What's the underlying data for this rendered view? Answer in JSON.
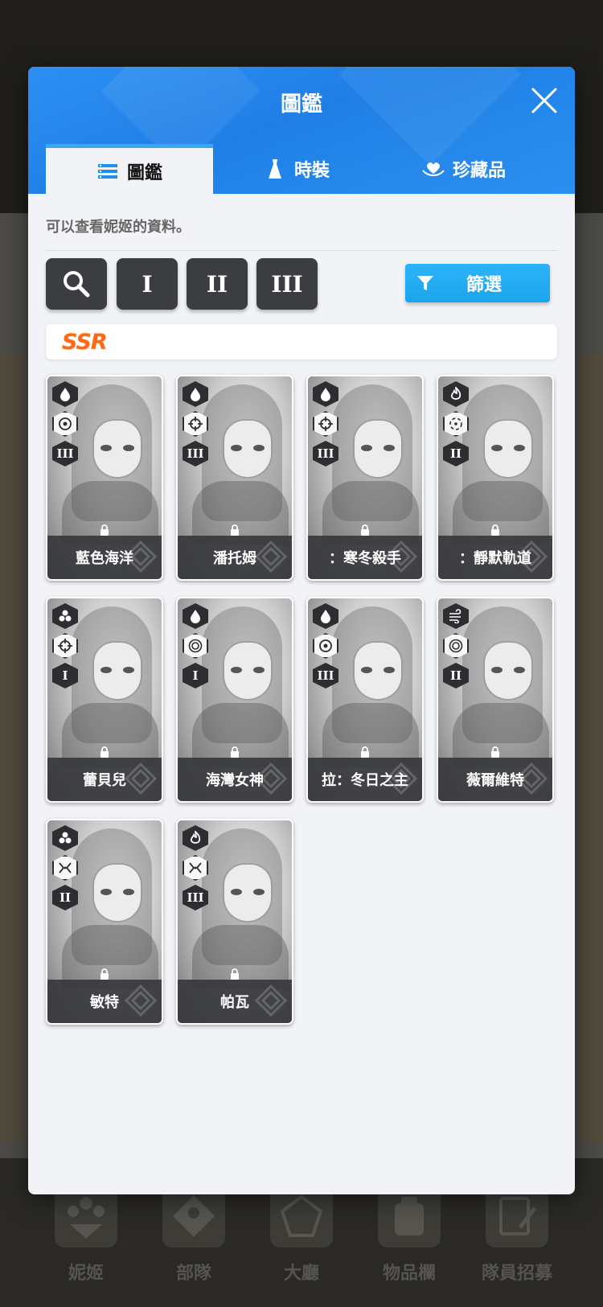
{
  "dialog": {
    "title": "圖鑑",
    "close_icon": "close-icon"
  },
  "tabs": [
    {
      "label": "圖鑑",
      "icon": "list-icon",
      "active": true
    },
    {
      "label": "時裝",
      "icon": "dress-icon",
      "active": false
    },
    {
      "label": "珍藏品",
      "icon": "heart-hands-icon",
      "active": false
    }
  ],
  "description": "可以查看妮姬的資料。",
  "toolbar": {
    "search_icon": "search-icon",
    "burst_buttons": [
      "I",
      "II",
      "III"
    ],
    "filter_label": "篩選",
    "filter_icon": "funnel-icon"
  },
  "rarity_label": "SSR",
  "colors": {
    "header_blue": "#1f7fe6",
    "tab_accent": "#3aa7f5",
    "filter_blue": "#1aa5ef",
    "ssr_orange": "#ff6a1a",
    "dark_button": "#3c3d41"
  },
  "characters": [
    {
      "name": "藍色海洋",
      "element": "water-drop-icon",
      "weapon": "target-dot-icon",
      "burst": "III",
      "locked": true
    },
    {
      "name": "潘托姆",
      "element": "water-drop-icon",
      "weapon": "crosshair-icon",
      "burst": "III",
      "locked": true
    },
    {
      "name": "：寒冬殺手",
      "element": "water-drop-icon",
      "weapon": "crosshair-icon",
      "burst": "III",
      "locked": true
    },
    {
      "name": "：靜默軌道",
      "element": "fire-icon",
      "weapon": "scope-icon",
      "burst": "II",
      "locked": true
    },
    {
      "name": "蕾貝兒",
      "element": "iron-icon",
      "weapon": "crosshair-icon",
      "burst": "I",
      "locked": true
    },
    {
      "name": "海灣女神",
      "element": "water-drop-icon",
      "weapon": "ring-target-icon",
      "burst": "I",
      "locked": true
    },
    {
      "name": "拉：冬日之主",
      "element": "water-drop-icon",
      "weapon": "target-dot-icon",
      "burst": "III",
      "locked": true
    },
    {
      "name": "薇爾維特",
      "element": "wind-icon",
      "weapon": "ring-target-icon",
      "burst": "II",
      "locked": true
    },
    {
      "name": "敏特",
      "element": "iron-icon",
      "weapon": "spread-icon",
      "burst": "II",
      "locked": true
    },
    {
      "name": "帕瓦",
      "element": "fire-icon",
      "weapon": "spread-icon",
      "burst": "III",
      "locked": true
    }
  ],
  "bottom_nav": [
    {
      "label": "妮姬",
      "icon": "nikke-icon"
    },
    {
      "label": "部隊",
      "icon": "squad-icon"
    },
    {
      "label": "大廳",
      "icon": "lobby-icon"
    },
    {
      "label": "物品欄",
      "icon": "inventory-icon"
    },
    {
      "label": "隊員招募",
      "icon": "recruit-icon"
    }
  ]
}
